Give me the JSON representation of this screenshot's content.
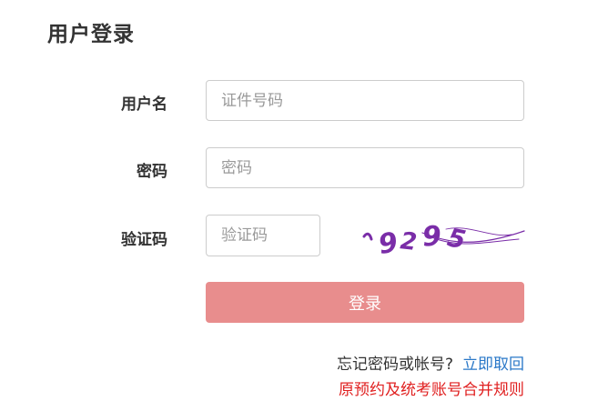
{
  "page_title": "用户登录",
  "form": {
    "username_label": "用户名",
    "username_placeholder": "证件号码",
    "password_label": "密码",
    "password_placeholder": "密码",
    "captcha_label": "验证码",
    "captcha_placeholder": "验证码",
    "captcha_text": "9295",
    "login_button": "登录"
  },
  "footer": {
    "forgot_text": "忘记密码或帐号?",
    "recover_link": "立即取回",
    "rules_link": "原预约及统考账号合并规则"
  },
  "colors": {
    "login_button_bg": "#e88d8d",
    "link_blue": "#2a78c8",
    "link_red": "#e02020",
    "captcha_purple": "#7a2da8"
  }
}
